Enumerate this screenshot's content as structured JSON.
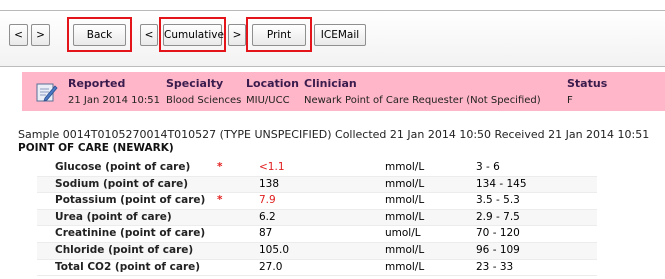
{
  "toolbar": {
    "prev_label": "<",
    "next_label": ">",
    "back_label": "Back",
    "cum_prev_label": "<",
    "cumulative_label": "Cumulative",
    "cum_next_label": ">",
    "print_label": "Print",
    "icemail_label": "ICEMail"
  },
  "header": {
    "reported_title": "Reported",
    "reported_value": "21 Jan 2014 10:51",
    "specialty_title": "Specialty",
    "specialty_value": "Blood Sciences",
    "location_title": "Location",
    "location_value": "MIU/UCC",
    "clinician_title": "Clinician",
    "clinician_value": "Newark Point of Care Requester (Not Specified)",
    "status_title": "Status",
    "status_value": "F"
  },
  "sample": {
    "text": "Sample 0014T0105270014T010527 (TYPE UNSPECIFIED)  Collected 21 Jan 2014 10:50 Received 21 Jan 2014 10:51"
  },
  "section": {
    "title": "POINT OF CARE (NEWARK)"
  },
  "results": [
    {
      "name": "Glucose (point of care)",
      "flag": "*",
      "value": "<1.1",
      "unit": "mmol/L",
      "range": "3 - 6",
      "abnormal": true
    },
    {
      "name": "Sodium (point of care)",
      "flag": "",
      "value": "138",
      "unit": "mmol/L",
      "range": "134 - 145",
      "abnormal": false
    },
    {
      "name": "Potassium (point of care)",
      "flag": "*",
      "value": "7.9",
      "unit": "mmol/L",
      "range": "3.5 - 5.3",
      "abnormal": true
    },
    {
      "name": "Urea (point of care)",
      "flag": "",
      "value": "6.2",
      "unit": "mmol/L",
      "range": "2.9 - 7.5",
      "abnormal": false
    },
    {
      "name": "Creatinine (point of care)",
      "flag": "",
      "value": "87",
      "unit": "umol/L",
      "range": "70 - 120",
      "abnormal": false
    },
    {
      "name": "Chloride (point of care)",
      "flag": "",
      "value": "105.0",
      "unit": "mmol/L",
      "range": "96 - 109",
      "abnormal": false
    },
    {
      "name": "Total CO2 (point of care)",
      "flag": "",
      "value": "27.0",
      "unit": "mmol/L",
      "range": "23 - 33",
      "abnormal": false
    }
  ],
  "colors": {
    "header_bg": "#ffb6c8",
    "highlight_outline": "#e4141b",
    "abnormal_text": "#e02020"
  }
}
